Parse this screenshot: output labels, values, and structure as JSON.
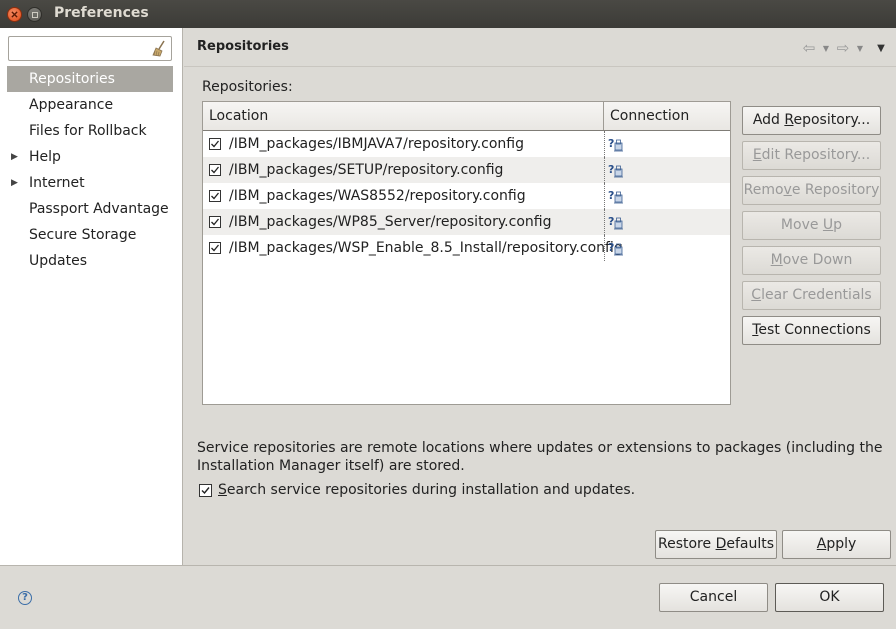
{
  "window": {
    "title": "Preferences"
  },
  "filter": {
    "value": "",
    "placeholder": ""
  },
  "nav": {
    "items": [
      {
        "label": "Repositories",
        "selected": true,
        "expandable": false
      },
      {
        "label": "Appearance",
        "selected": false,
        "expandable": false
      },
      {
        "label": "Files for Rollback",
        "selected": false,
        "expandable": false
      },
      {
        "label": "Help",
        "selected": false,
        "expandable": true
      },
      {
        "label": "Internet",
        "selected": false,
        "expandable": true
      },
      {
        "label": "Passport Advantage",
        "selected": false,
        "expandable": false
      },
      {
        "label": "Secure Storage",
        "selected": false,
        "expandable": false
      },
      {
        "label": "Updates",
        "selected": false,
        "expandable": false
      }
    ]
  },
  "page": {
    "title": "Repositories",
    "repositories_label": "Repositories:",
    "table": {
      "columns": [
        "Location",
        "Connection"
      ],
      "rows": [
        {
          "checked": true,
          "location": "/IBM_packages/IBMJAVA7/repository.config",
          "connection_icon": "unknown-connection-icon"
        },
        {
          "checked": true,
          "location": "/IBM_packages/SETUP/repository.config",
          "connection_icon": "unknown-connection-icon"
        },
        {
          "checked": true,
          "location": "/IBM_packages/WAS8552/repository.config",
          "connection_icon": "unknown-connection-icon"
        },
        {
          "checked": true,
          "location": "/IBM_packages/WP85_Server/repository.config",
          "connection_icon": "unknown-connection-icon"
        },
        {
          "checked": true,
          "location": "/IBM_packages/WSP_Enable_8.5_Install/repository.config",
          "connection_icon": "unknown-connection-icon"
        }
      ]
    },
    "buttons": {
      "add": {
        "pre": "Add ",
        "mn": "R",
        "post": "epository...",
        "enabled": true
      },
      "edit": {
        "pre": "",
        "mn": "E",
        "post": "dit Repository...",
        "enabled": false
      },
      "remove": {
        "pre": "Remo",
        "mn": "v",
        "post": "e Repository",
        "enabled": false
      },
      "move_up": {
        "pre": "Move ",
        "mn": "U",
        "post": "p",
        "enabled": false
      },
      "move_down": {
        "pre": "",
        "mn": "M",
        "post": "ove Down",
        "enabled": false
      },
      "clear": {
        "pre": "",
        "mn": "C",
        "post": "lear Credentials",
        "enabled": false
      },
      "test": {
        "pre": "",
        "mn": "T",
        "post": "est Connections",
        "enabled": true
      }
    },
    "note": "Service repositories are remote locations where updates or extensions to packages (including the Installation Manager itself) are stored.",
    "search_checkbox": {
      "checked": true,
      "pre": "",
      "mn": "S",
      "post": "earch service repositories during installation and updates."
    },
    "restore": {
      "pre": "Restore ",
      "mn": "D",
      "post": "efaults"
    },
    "apply": {
      "pre": "",
      "mn": "A",
      "post": "pply"
    }
  },
  "footer": {
    "cancel_label": "Cancel",
    "ok_label": "OK",
    "help_icon": "help-icon"
  },
  "colors": {
    "selected_nav": "#a9a7a1",
    "titlebar": "#3c3b37",
    "close_button": "#df4a16",
    "background": "#dcdad5"
  }
}
